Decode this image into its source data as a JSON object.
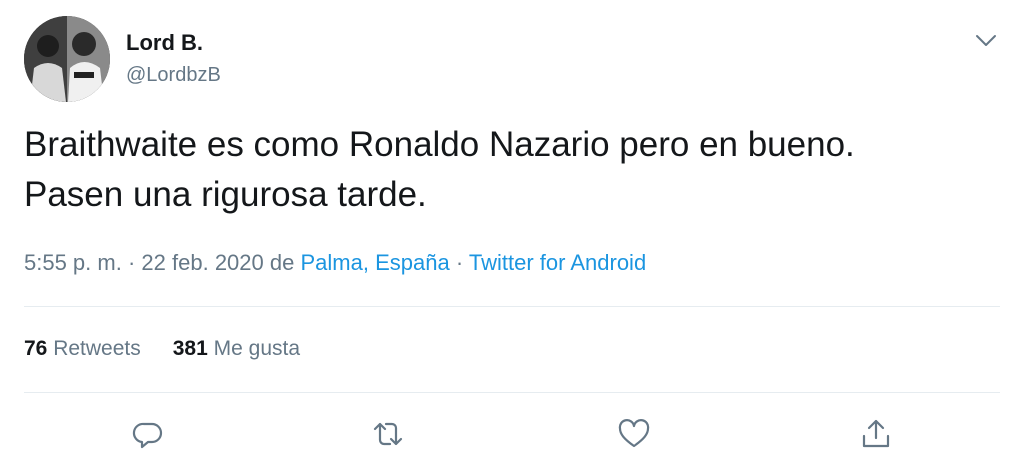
{
  "author": {
    "name": "Lord B.",
    "handle": "@LordbzB"
  },
  "tweet": {
    "text_lines": [
      "Braithwaite es como Ronaldo Nazario pero en bueno.",
      "Pasen una rigurosa tarde."
    ],
    "time": "5:55 p. m.",
    "separator": "·",
    "date": "22 feb. 2020",
    "location_prefix": "de",
    "location": "Palma, España",
    "source": "Twitter for Android"
  },
  "stats": {
    "retweets_count": "76",
    "retweets_label": "Retweets",
    "likes_count": "381",
    "likes_label": "Me gusta"
  },
  "icons": {
    "menu": "chevron-down-icon",
    "reply": "reply-icon",
    "retweet": "retweet-icon",
    "like": "heart-icon",
    "share": "share-icon"
  },
  "colors": {
    "link": "#1b95e0",
    "secondary_text": "#657786",
    "primary_text": "#14171a",
    "divider": "#e6ecf0"
  }
}
